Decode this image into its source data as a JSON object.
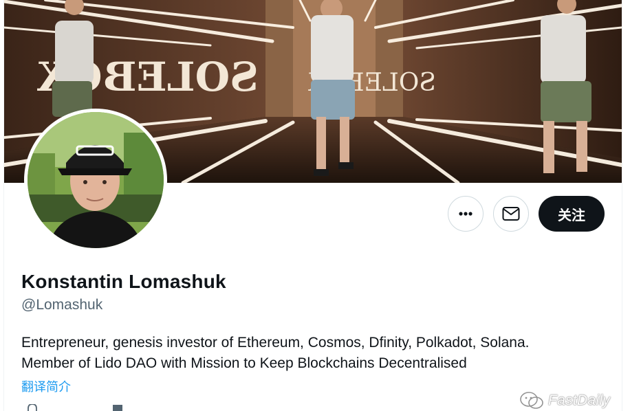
{
  "profile": {
    "name": "Konstantin Lomashuk",
    "handle": "@Lomashuk",
    "bio_lines": [
      "Entrepreneur, genesis investor of Ethereum, Cosmos, Dfinity, Polkadot, Solana.",
      "Member of Lido DAO with Mission to Keep Blockchains Decentralised"
    ],
    "translate_label": "翻译简介"
  },
  "actions": {
    "more_icon": "more-horizontal-icon",
    "message_icon": "envelope-icon",
    "follow_label": "关注"
  },
  "banner": {
    "sign_left": "SOLEBOX",
    "sign_right": "SOLEBOX"
  },
  "watermark": {
    "text": "FastDaily",
    "icon": "wechat-icon"
  },
  "colors": {
    "text_primary": "#0f1419",
    "text_secondary": "#536471",
    "link": "#1d9bf0",
    "button_dark": "#0f1419",
    "border": "#cfd9de"
  }
}
